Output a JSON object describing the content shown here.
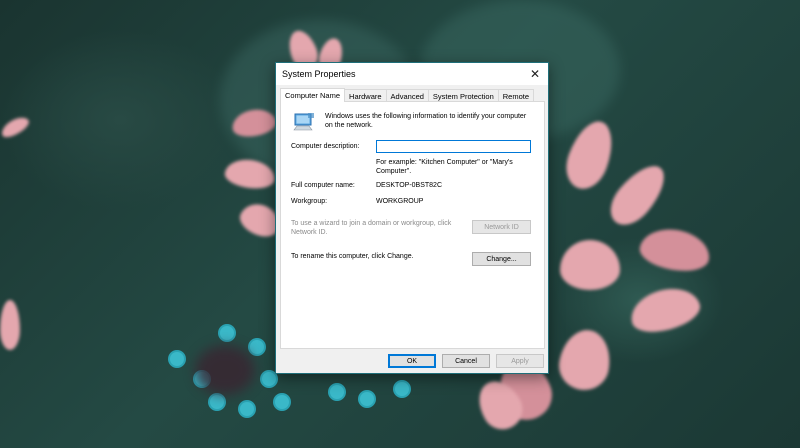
{
  "dialog": {
    "title": "System Properties",
    "close_glyph": "✕",
    "tabs": [
      {
        "label": "Computer Name",
        "active": true
      },
      {
        "label": "Hardware",
        "active": false
      },
      {
        "label": "Advanced",
        "active": false
      },
      {
        "label": "System Protection",
        "active": false
      },
      {
        "label": "Remote",
        "active": false
      }
    ],
    "intro_text": "Windows uses the following information to identify your computer on the network.",
    "computer_description_label": "Computer description:",
    "computer_description_value": "",
    "example_text": "For example: \"Kitchen Computer\" or \"Mary's Computer\".",
    "full_name_label": "Full computer name:",
    "full_name_value": "DESKTOP-0BST82C",
    "workgroup_label": "Workgroup:",
    "workgroup_value": "WORKGROUP",
    "network_id_text": "To use a wizard to join a domain or workgroup, click Network ID.",
    "network_id_button": "Network ID",
    "rename_text": "To rename this computer, click Change.",
    "change_button": "Change...",
    "ok_button": "OK",
    "cancel_button": "Cancel",
    "apply_button": "Apply",
    "icon": "computer-network-icon",
    "accent_color": "#0078d7"
  }
}
